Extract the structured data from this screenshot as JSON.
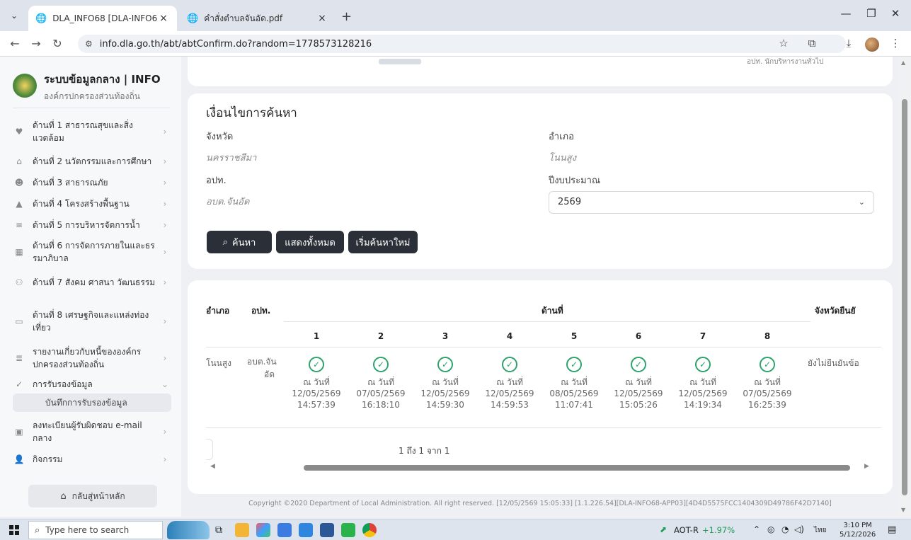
{
  "browser": {
    "tabs": [
      {
        "label": "DLA_INFO68 [DLA-INFO68-APP",
        "close": "×"
      },
      {
        "label": "คำสั่งตำบลจันอัด.pdf",
        "close": "×"
      }
    ],
    "new_tab": "+",
    "url": "info.dla.go.th/abt/abtConfirm.do?random=1778573128216"
  },
  "sidebar": {
    "title": "ระบบข้อมูลกลาง | INFO",
    "subtitle": "องค์กรปกครองส่วนท้องถิ่น",
    "items": [
      {
        "label": "ด้านที่ 1 สาธารณสุขและสิ่งแวดล้อม",
        "icon": "heart-icon"
      },
      {
        "label": "ด้านที่ 2 นวัตกรรมและการศึกษา",
        "icon": "school-icon"
      },
      {
        "label": "ด้านที่ 3 สาธารณภัย",
        "icon": "people-icon"
      },
      {
        "label": "ด้านที่ 4 โครงสร้างพื้นฐาน",
        "icon": "road-icon"
      },
      {
        "label": "ด้านที่ 5 การบริหารจัดการน้ำ",
        "icon": "water-icon"
      },
      {
        "label": "ด้านที่ 6 การจัดการภายในและธรรมาภิบาล",
        "icon": "building-icon"
      },
      {
        "label": "ด้านที่ 7 สังคม ศาสนา วัฒนธรรม",
        "icon": "group-icon"
      },
      {
        "label": "ด้านที่ 8 เศรษฐกิจและแหล่งท่องเที่ยว",
        "icon": "money-icon"
      },
      {
        "label": "รายงานเกี่ยวกับหนี้ขององค์กรปกครองส่วนท้องถิ่น",
        "icon": "stack-icon"
      },
      {
        "label": "การรับรองข้อมูล",
        "icon": "check-icon"
      },
      {
        "label": "ลงทะเบียนผู้รับผิดชอบ e-mail กลาง",
        "icon": "register-icon"
      },
      {
        "label": "กิจกรรม",
        "icon": "user-icon"
      }
    ],
    "sub_item": "บันทึกการรับรองข้อมูล",
    "home_button": "กลับสู่หน้าหลัก"
  },
  "top_card": {
    "fragment": "อปท.  นักบริหารงานทั่วไป"
  },
  "search": {
    "title": "เงื่อนไขการค้นหา",
    "province_label": "จังหวัด",
    "province_value": "นครราชสีมา",
    "district_label": "อำเภอ",
    "district_value": "โนนสูง",
    "org_label": "อปท.",
    "org_value": "อบต.จันอัด",
    "year_label": "ปีงบประมาณ",
    "year_value": "2569",
    "buttons": {
      "search": "ค้นหา",
      "show_all": "แสดงทั้งหมด",
      "reset": "เริ่มค้นหาใหม่"
    }
  },
  "results": {
    "headers": {
      "district": "อำเภอ",
      "org": "อปท.",
      "aspect": "ด้านที่",
      "province_confirm": "จังหวัดยืนยั"
    },
    "aspect_numbers": [
      "1",
      "2",
      "3",
      "4",
      "5",
      "6",
      "7",
      "8"
    ],
    "row": {
      "district": "โนนสูง",
      "org_line1": "อบต.จัน",
      "org_line2": "อัด",
      "province_status": "ยังไม่ยืนยันข้อ",
      "statuses": [
        {
          "prefix": "ณ วันที่",
          "date": "12/05/2569",
          "time": "14:57:39"
        },
        {
          "prefix": "ณ วันที่",
          "date": "07/05/2569",
          "time": "16:18:10"
        },
        {
          "prefix": "ณ วันที่",
          "date": "12/05/2569",
          "time": "14:59:30"
        },
        {
          "prefix": "ณ วันที่",
          "date": "12/05/2569",
          "time": "14:59:53"
        },
        {
          "prefix": "ณ วันที่",
          "date": "08/05/2569",
          "time": "11:07:41"
        },
        {
          "prefix": "ณ วันที่",
          "date": "12/05/2569",
          "time": "15:05:26"
        },
        {
          "prefix": "ณ วันที่",
          "date": "12/05/2569",
          "time": "14:19:34"
        },
        {
          "prefix": "ณ วันที่",
          "date": "07/05/2569",
          "time": "16:25:39"
        }
      ]
    },
    "pager": "1 ถึง 1 จาก 1"
  },
  "footer": "Copyright ©2020 Department of Local Administration. All right reserved. [12/05/2569 15:05:33] [1.1.226.54][DLA-INFO68-APP03][4D4D5575FCC1404309D49786F42D7140]",
  "taskbar": {
    "search_placeholder": "Type here to search",
    "stock_name": "AOT-R",
    "stock_change": "+1.97%",
    "lang": "ไทย",
    "time": "3:10 PM",
    "date": "5/12/2026"
  },
  "colors": {
    "accent_dark": "#2b3038",
    "success": "#2ea36b",
    "stock_up": "#1e9e55"
  }
}
